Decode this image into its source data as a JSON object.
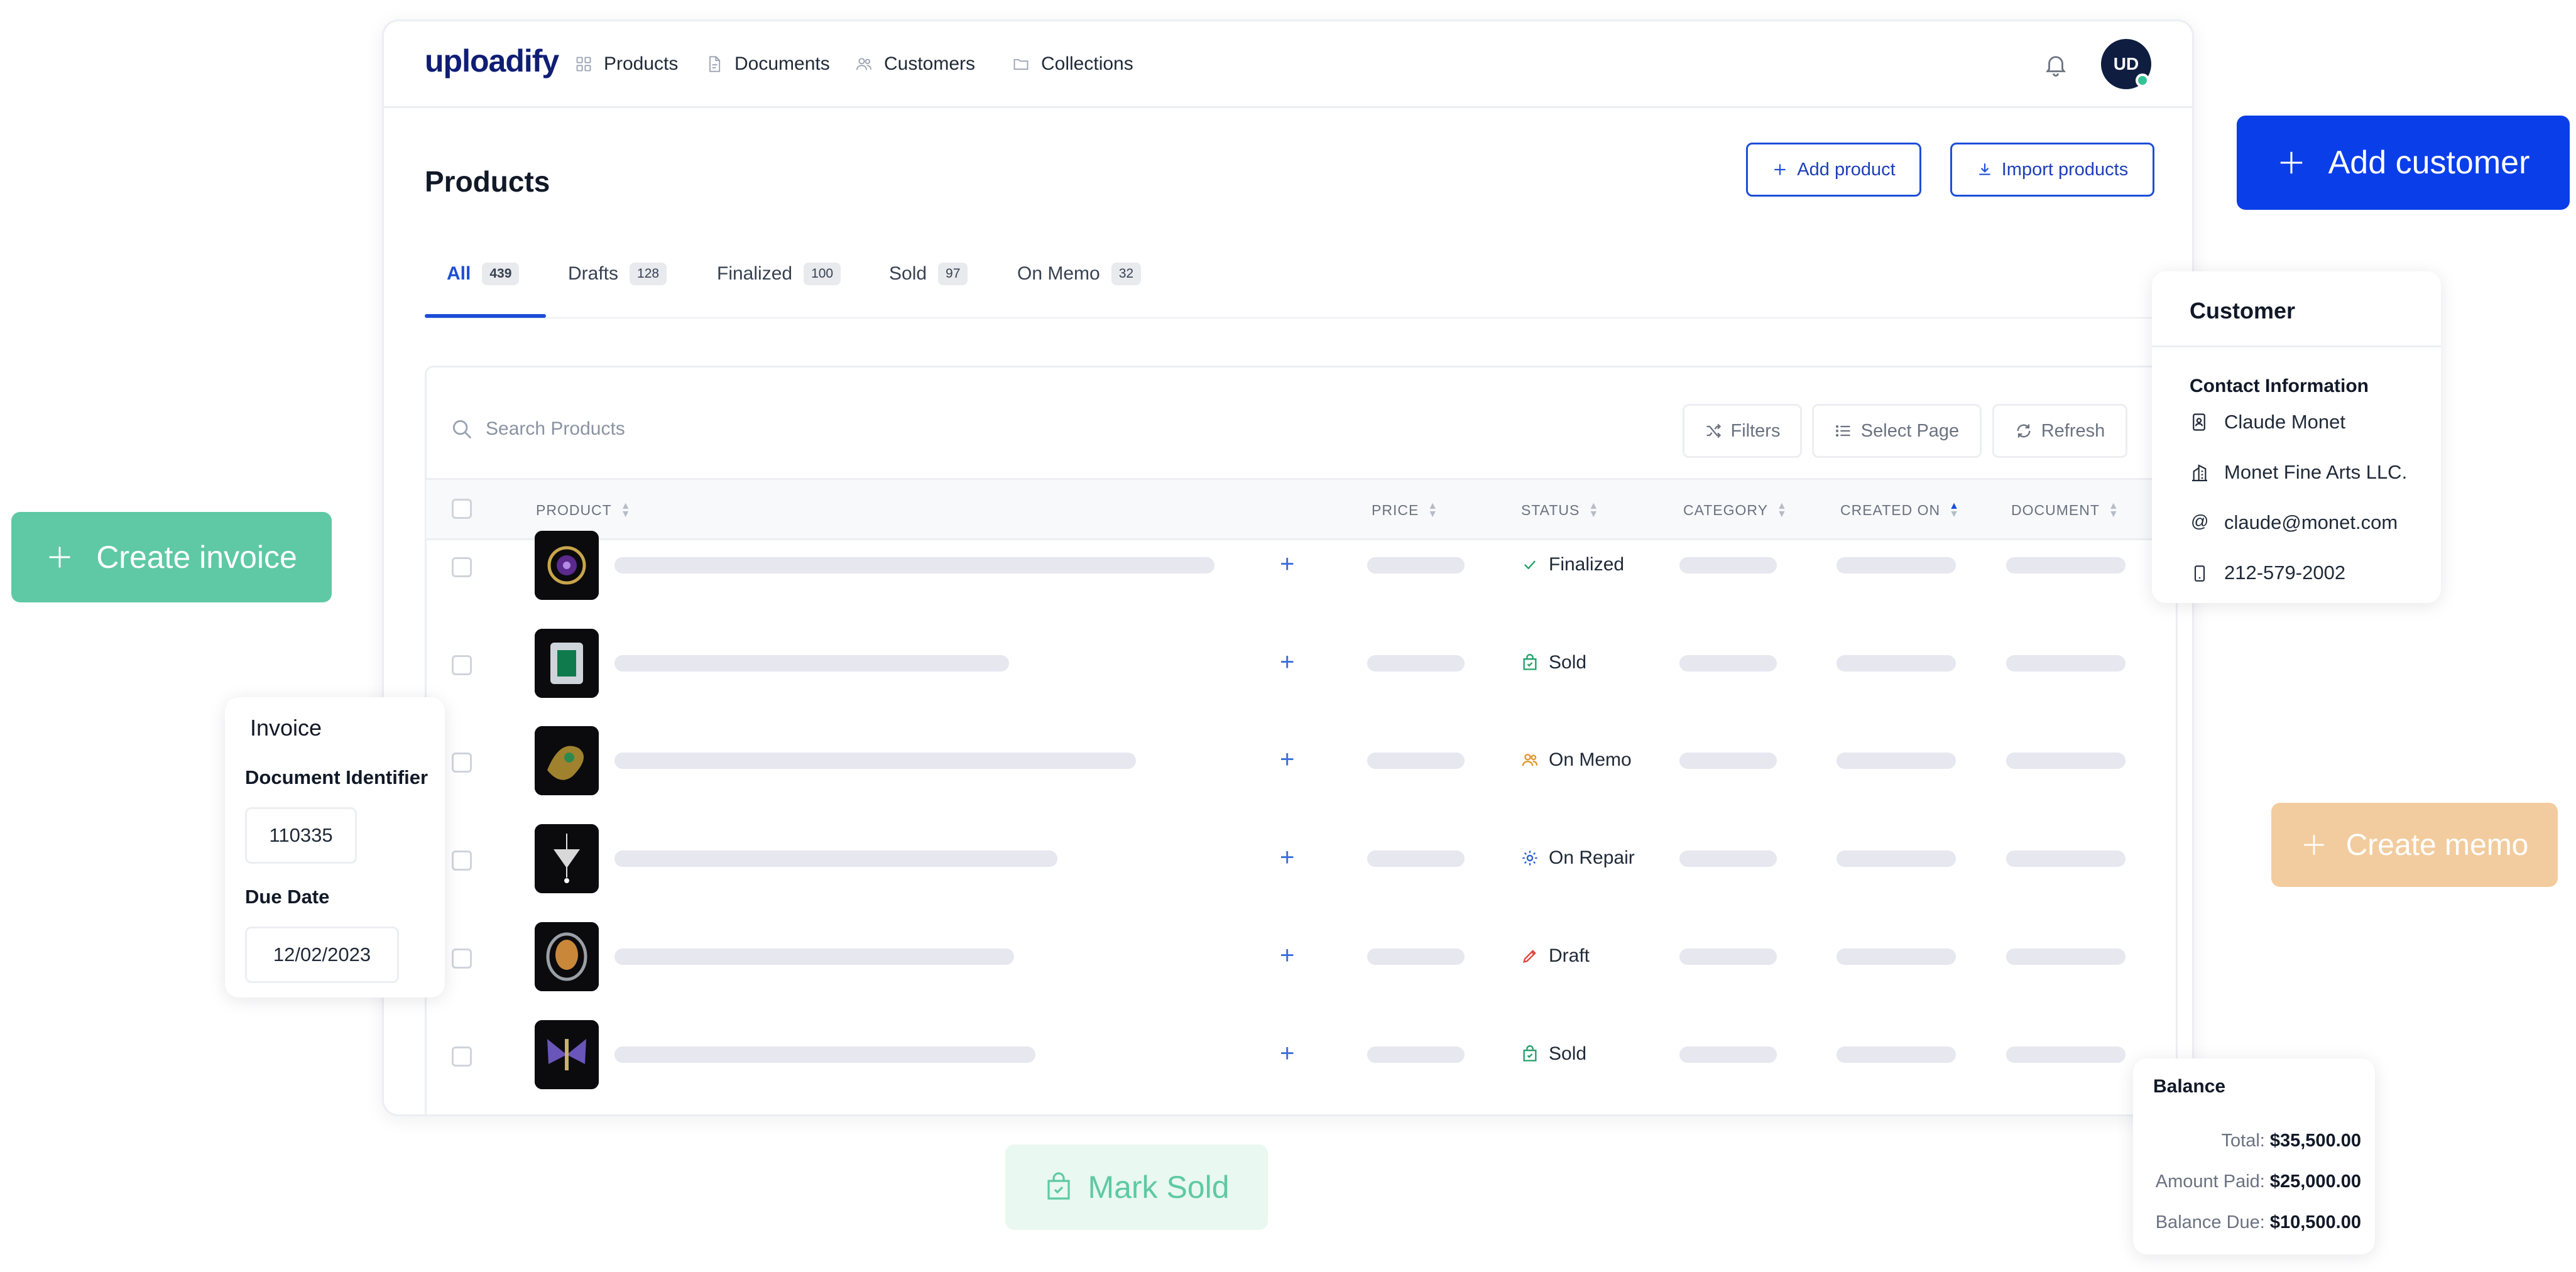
{
  "app": {
    "logo": "uploadify",
    "nav": [
      {
        "label": "Products",
        "icon": "grid-icon"
      },
      {
        "label": "Documents",
        "icon": "document-icon"
      },
      {
        "label": "Customers",
        "icon": "users-icon"
      },
      {
        "label": "Collections",
        "icon": "folder-icon"
      }
    ],
    "avatar_initials": "UD",
    "avatar_status_color": "#34c397"
  },
  "page": {
    "title": "Products",
    "add_product_label": "Add product",
    "import_products_label": "Import products"
  },
  "tabs": [
    {
      "label": "All",
      "count": "439",
      "active": true
    },
    {
      "label": "Drafts",
      "count": "128"
    },
    {
      "label": "Finalized",
      "count": "100"
    },
    {
      "label": "Sold",
      "count": "97"
    },
    {
      "label": "On Memo",
      "count": "32"
    }
  ],
  "toolbar": {
    "search_placeholder": "Search Products",
    "filters_label": "Filters",
    "select_page_label": "Select Page",
    "refresh_label": "Refresh"
  },
  "table": {
    "columns": [
      "PRODUCT",
      "PRICE",
      "STATUS",
      "CATEGORY",
      "CREATED ON",
      "DOCUMENT"
    ],
    "rows": [
      {
        "status": "Finalized",
        "status_icon": "check-icon",
        "status_color": "#22a06b",
        "thumb": "amethyst-ring"
      },
      {
        "status": "Sold",
        "status_icon": "bag-icon",
        "status_color": "#22a06b",
        "thumb": "emerald-ring"
      },
      {
        "status": "On Memo",
        "status_icon": "users-icon",
        "status_color": "#e0962a",
        "thumb": "gold-brooch"
      },
      {
        "status": "On Repair",
        "status_icon": "gear-icon",
        "status_color": "#2f5fd8",
        "thumb": "diamond-pendant"
      },
      {
        "status": "Draft",
        "status_icon": "pencil-icon",
        "status_color": "#e0453a",
        "thumb": "topaz-ring"
      },
      {
        "status": "Sold",
        "status_icon": "bag-icon",
        "status_color": "#22a06b",
        "thumb": "butterfly-brooch"
      }
    ]
  },
  "floating": {
    "add_customer_label": "Add customer",
    "create_invoice_label": "Create invoice",
    "create_memo_label": "Create memo",
    "mark_sold_label": "Mark Sold",
    "colors": {
      "add_customer": "#0a3ee8",
      "create_invoice": "#5ec9a4",
      "create_memo": "#f2cc9e",
      "mark_sold_bg": "#e9f8f1",
      "mark_sold_fg": "#5ec9a4"
    }
  },
  "customer_card": {
    "title": "Customer",
    "section": "Contact Information",
    "name": "Claude Monet",
    "company": "Monet Fine Arts LLC.",
    "email": "claude@monet.com",
    "phone": "212-579-2002"
  },
  "invoice_card": {
    "title": "Invoice",
    "doc_id_label": "Document Identifier",
    "doc_id_value": "110335",
    "due_date_label": "Due Date",
    "due_date_value": "12/02/2023"
  },
  "balance_card": {
    "title": "Balance",
    "total_label": "Total:",
    "total_value": "$35,500.00",
    "paid_label": "Amount Paid:",
    "paid_value": "$25,000.00",
    "due_label": "Balance Due:",
    "due_value": "$10,500.00"
  }
}
